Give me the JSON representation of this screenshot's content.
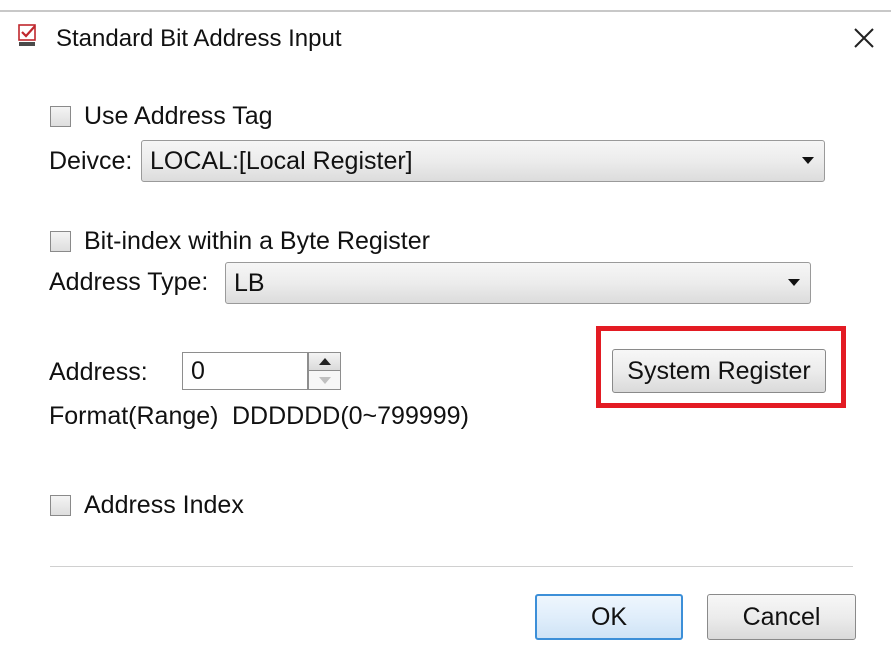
{
  "window": {
    "title": "Standard Bit Address Input",
    "icon": "checkmark-app-icon",
    "close_icon": "close-icon"
  },
  "use_address_tag": {
    "label": "Use Address Tag",
    "checked": false
  },
  "device": {
    "label": "Deivce:",
    "value": "LOCAL:[Local Register]"
  },
  "bit_index": {
    "label": "Bit-index within a Byte Register",
    "checked": false
  },
  "address_type": {
    "label": "Address Type:",
    "value": "LB"
  },
  "address": {
    "label": "Address:",
    "value": "0"
  },
  "format": {
    "label": "Format(Range)",
    "value": "DDDDDD(0~799999)"
  },
  "system_register_button": "System Register",
  "address_index": {
    "label": "Address Index",
    "checked": false
  },
  "buttons": {
    "ok": "OK",
    "cancel": "Cancel"
  },
  "colors": {
    "highlight": "#e31b23",
    "primary_border": "#3c8fd8"
  }
}
